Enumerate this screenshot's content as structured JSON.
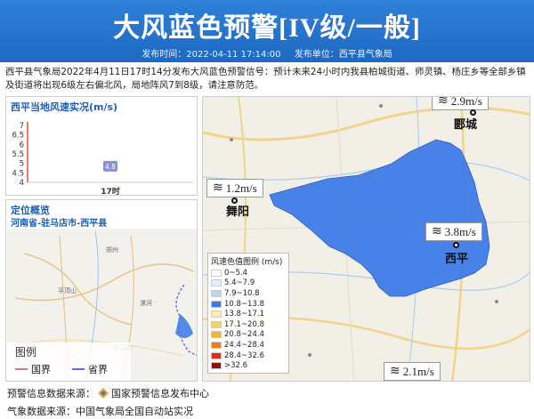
{
  "header": {
    "title": "大风蓝色预警[IV级/一般]",
    "publish_time_label": "发布时间：2022-04-11 17:14:00",
    "publisher_label": "发布单位：西平县气象局"
  },
  "description": "西平县气象局2022年4月11日17时14分发布大风蓝色预警信号：预计未来24小时内我县柏城街道、师灵镇、杨庄乡等全部乡镇及街道将出现6级左右偏北风，局地阵风7到8级，请注意防范。",
  "wind_panel": {
    "title": "西平当地风速实况(m/s)",
    "chart_data": {
      "type": "bar",
      "categories": [
        "17时"
      ],
      "values": [
        4.8
      ],
      "ylim": [
        4,
        7
      ],
      "yticks": [
        "7",
        "6.5",
        "6",
        "5.5",
        "5",
        "4.5",
        "4"
      ],
      "data_labels": [
        "4.8"
      ]
    }
  },
  "location_panel": {
    "title": "定位概览",
    "path": "河南省-驻马店市-西平县",
    "legend_title": "图例",
    "legend_items": [
      {
        "label": "国界",
        "color": "#c77a8a"
      },
      {
        "label": "省界",
        "color": "#5a6fd6"
      }
    ]
  },
  "map": {
    "wind_readings": [
      {
        "value": "2.9m/s"
      },
      {
        "value": "1.2m/s"
      },
      {
        "value": "3.8m/s"
      },
      {
        "value": "2.1m/s"
      }
    ],
    "cities": [
      "郾城",
      "舞阳",
      "西平"
    ],
    "warning_color": "#3a78e8",
    "legend_title": "风速色值图例 (m/s)",
    "legend": [
      {
        "label": "0~5.4",
        "color": "#ffffff"
      },
      {
        "label": "5.4~7.9",
        "color": "#e3eefb"
      },
      {
        "label": "7.9~10.8",
        "color": "#b9d4f5"
      },
      {
        "label": "10.8~13.8",
        "color": "#3a78e8"
      },
      {
        "label": "13.8~17.1",
        "color": "#fcecb0"
      },
      {
        "label": "17.1~20.8",
        "color": "#f9d25c"
      },
      {
        "label": "20.8~24.4",
        "color": "#f5b22a"
      },
      {
        "label": "24.4~28.4",
        "color": "#ef7d16"
      },
      {
        "label": "28.4~32.6",
        "color": "#d9301c"
      },
      {
        "label": ">32.6",
        "color": "#8e1010"
      }
    ]
  },
  "footer": {
    "warning_source": "预警信息数据来源：",
    "warning_source_name": "国家预警信息发布中心",
    "weather_source": "气象数据来源：中国气象局全国自动站实况"
  }
}
